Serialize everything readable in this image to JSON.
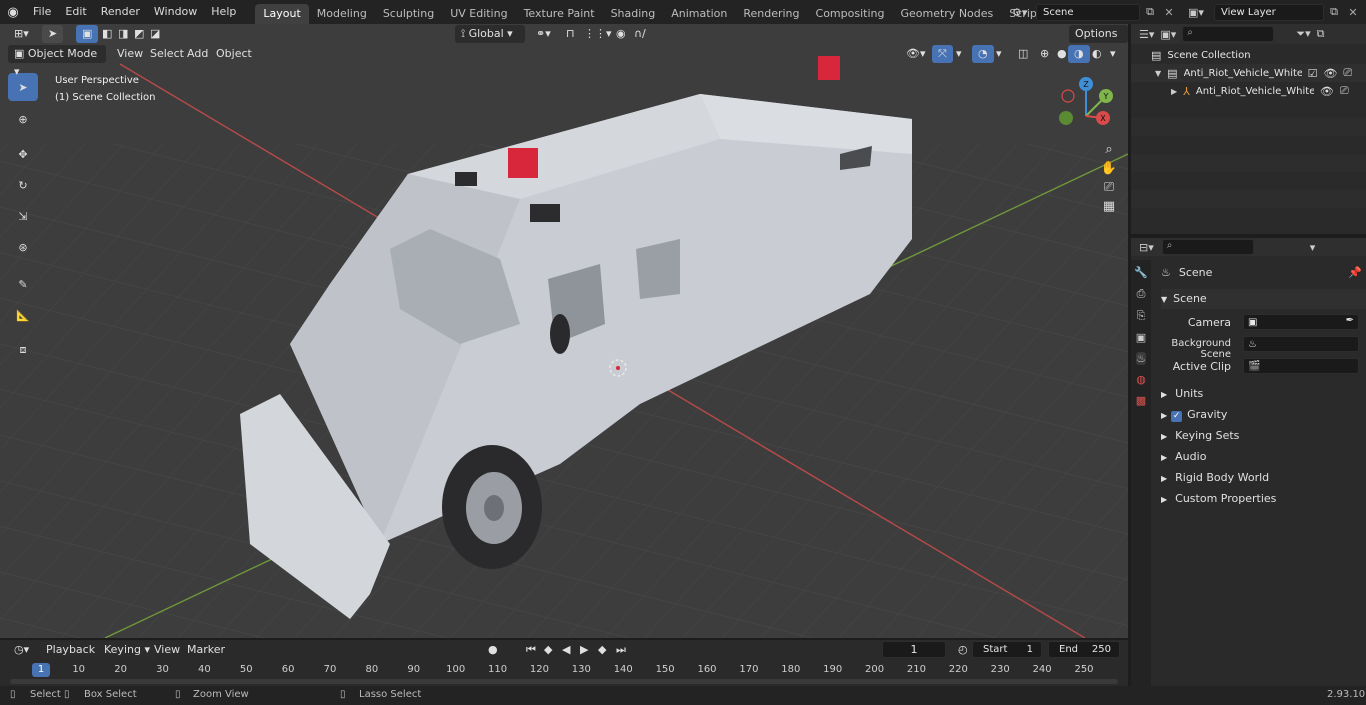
{
  "topbar": {
    "menus": [
      "File",
      "Edit",
      "Render",
      "Window",
      "Help"
    ],
    "workspaces": [
      "Layout",
      "Modeling",
      "Sculpting",
      "UV Editing",
      "Texture Paint",
      "Shading",
      "Animation",
      "Rendering",
      "Compositing",
      "Geometry Nodes",
      "Scripting"
    ],
    "active_workspace": "Layout",
    "add_tab": "+",
    "scene_name": "Scene",
    "view_layer": "View Layer"
  },
  "viewport": {
    "mode": "Object Mode",
    "menus": [
      "View",
      "Select",
      "Add",
      "Object"
    ],
    "orientation": "Global",
    "options": "Options",
    "overlay_title": "User Perspective",
    "overlay_subtitle": "(1) Scene Collection",
    "gizmo_axes": {
      "x": "X",
      "y": "Y",
      "z": "Z"
    }
  },
  "outliner": {
    "root": "Scene Collection",
    "items": [
      {
        "label": "Anti_Riot_Vehicle_White_Simp",
        "level": 1
      },
      {
        "label": "Anti_Riot_Vehicle_White_",
        "level": 2
      }
    ]
  },
  "properties": {
    "header": "Scene",
    "section": "Scene",
    "fields": [
      {
        "label": "Camera",
        "value": ""
      },
      {
        "label": "Background Scene",
        "value": ""
      },
      {
        "label": "Active Clip",
        "value": ""
      }
    ],
    "panels": [
      "Units",
      "Gravity",
      "Keying Sets",
      "Audio",
      "Rigid Body World",
      "Custom Properties"
    ],
    "gravity_checked": true
  },
  "timeline": {
    "menus": [
      "Playback",
      "Keying",
      "View",
      "Marker"
    ],
    "current_frame": "1",
    "start_label": "Start",
    "start": "1",
    "end_label": "End",
    "end": "250",
    "ticks": [
      "1",
      "10",
      "20",
      "30",
      "40",
      "50",
      "60",
      "70",
      "80",
      "90",
      "100",
      "110",
      "120",
      "130",
      "140",
      "150",
      "160",
      "170",
      "180",
      "190",
      "200",
      "210",
      "220",
      "230",
      "240",
      "250"
    ]
  },
  "statusbar": {
    "items": [
      "Select",
      "Box Select",
      "Zoom View",
      "Lasso Select"
    ],
    "version": "2.93.10"
  },
  "colors": {
    "accent": "#4772b3",
    "x_axis": "#d94a4a",
    "y_axis": "#7fb54a",
    "z_axis": "#3f8fd8"
  }
}
